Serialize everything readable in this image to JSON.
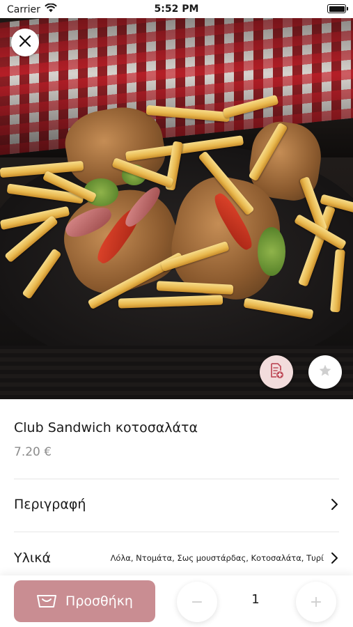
{
  "status_bar": {
    "carrier": "Carrier",
    "time": "5:52 PM"
  },
  "hero": {
    "image_alt": "Club sandwich with french fries"
  },
  "product": {
    "name": "Club Sandwich κοτοσαλάτα",
    "price": "7.20 €"
  },
  "rows": {
    "description_label": "Περιγραφή",
    "ingredients_label": "Υλικά",
    "ingredients_value": "Λόλα, Ντομάτα, Σως μουστάρδας, Κοτοσαλάτα, Τυρί"
  },
  "cart": {
    "add_label": "Προσθήκη",
    "quantity": "1",
    "minus": "−",
    "plus": "+"
  },
  "colors": {
    "accent": "#c98d92",
    "note_button_bg": "#f2dcdc"
  },
  "icons": {
    "close": "close-icon",
    "wifi": "wifi-icon",
    "battery": "battery-icon",
    "note": "note-add-icon",
    "favorite": "star-icon",
    "chevron": "chevron-right-icon",
    "cart": "basket-icon"
  }
}
